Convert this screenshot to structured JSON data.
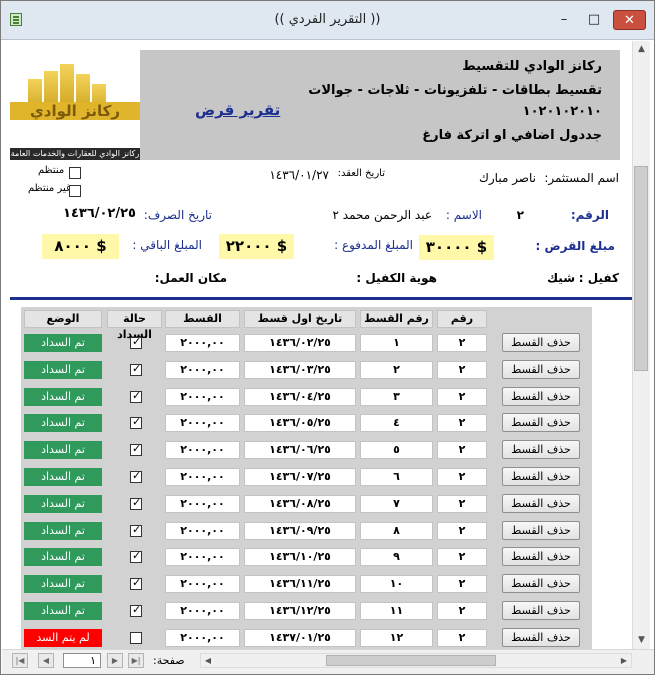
{
  "window": {
    "title": "(( التقرير الفردي ))",
    "controls": {
      "minimize": "–",
      "maximize": "□",
      "close": "✕"
    }
  },
  "logo": {
    "brand": "ركانز الوادي",
    "tagline": "ركانز الوادي للعقارات والخدمات العامة"
  },
  "header": {
    "report_title": "تقرير قرض",
    "company_name": "ركانز الوادي للتقسيط",
    "products": "تقسيط بطاقات - تلفزيونات - ثلاجات - جوالات",
    "phone": "١٠٢٠١٠٢٠١٠",
    "subtitle": "جددول اضافي او اتركة فارغ"
  },
  "info": {
    "investor_label": "اسم المستثمر:",
    "investor_value": "ناصر مبارك",
    "contract_date_label": "تاريخ العقد:",
    "contract_date_value": "١٤٣٦/٠١/٢٧",
    "regular_label": "منتظم",
    "irregular_label": "غير منتظم",
    "number_label": "الرقم:",
    "number_value": "٢",
    "name_label": "الاسم :",
    "name_value": "عبد الرحمن محمد ٢",
    "disbursement_label": "تاريخ الصرف:",
    "disbursement_value": "١٤٣٦/٠٢/٢٥",
    "loan_amount_label": "مبلغ القرض :",
    "loan_amount_value": "٣٠٠٠٠ $",
    "paid_amount_label": "المبلغ المدفوع :",
    "paid_amount_value": "٢٢٠٠٠ $",
    "remaining_label": "المبلغ الباقي :",
    "remaining_value": "٨٠٠٠ $",
    "guarantor_label": "كفيل :",
    "guarantor_value": "شيك",
    "guarantor_id_label": "هوية الكفيل :",
    "workplace_label": "مكان العمل:"
  },
  "table": {
    "headers": {
      "number": "رقم",
      "installment_number": "رقم القسط",
      "first_date": "تاريخ اول قسط",
      "installment": "القسط",
      "payment_status": "حالة السداد",
      "state": "الوضع"
    },
    "delete_label": "حذف القسط",
    "rows": [
      {
        "number": "٢",
        "installment_number": "١",
        "date": "١٤٣٦/٠٢/٢٥",
        "amount": "٢٠٠٠,٠٠",
        "paid": true,
        "status": "تم السداد"
      },
      {
        "number": "٢",
        "installment_number": "٢",
        "date": "١٤٣٦/٠٣/٢٥",
        "amount": "٢٠٠٠,٠٠",
        "paid": true,
        "status": "تم السداد"
      },
      {
        "number": "٢",
        "installment_number": "٣",
        "date": "١٤٣٦/٠٤/٢٥",
        "amount": "٢٠٠٠,٠٠",
        "paid": true,
        "status": "تم السداد"
      },
      {
        "number": "٢",
        "installment_number": "٤",
        "date": "١٤٣٦/٠٥/٢٥",
        "amount": "٢٠٠٠,٠٠",
        "paid": true,
        "status": "تم السداد"
      },
      {
        "number": "٢",
        "installment_number": "٥",
        "date": "١٤٣٦/٠٦/٢٥",
        "amount": "٢٠٠٠,٠٠",
        "paid": true,
        "status": "تم السداد"
      },
      {
        "number": "٢",
        "installment_number": "٦",
        "date": "١٤٣٦/٠٧/٢٥",
        "amount": "٢٠٠٠,٠٠",
        "paid": true,
        "status": "تم السداد"
      },
      {
        "number": "٢",
        "installment_number": "٧",
        "date": "١٤٣٦/٠٨/٢٥",
        "amount": "٢٠٠٠,٠٠",
        "paid": true,
        "status": "تم السداد"
      },
      {
        "number": "٢",
        "installment_number": "٨",
        "date": "١٤٣٦/٠٩/٢٥",
        "amount": "٢٠٠٠,٠٠",
        "paid": true,
        "status": "تم السداد"
      },
      {
        "number": "٢",
        "installment_number": "٩",
        "date": "١٤٣٦/١٠/٢٥",
        "amount": "٢٠٠٠,٠٠",
        "paid": true,
        "status": "تم السداد"
      },
      {
        "number": "٢",
        "installment_number": "١٠",
        "date": "١٤٣٦/١١/٢٥",
        "amount": "٢٠٠٠,٠٠",
        "paid": true,
        "status": "تم السداد"
      },
      {
        "number": "٢",
        "installment_number": "١١",
        "date": "١٤٣٦/١٢/٢٥",
        "amount": "٢٠٠٠,٠٠",
        "paid": true,
        "status": "تم السداد"
      },
      {
        "number": "٢",
        "installment_number": "١٢",
        "date": "١٤٣٧/٠١/٢٥",
        "amount": "٢٠٠٠,٠٠",
        "paid": false,
        "status": "لم يتم السد"
      }
    ]
  },
  "footer": {
    "page_label": "صفحة:",
    "page_value": "١"
  },
  "colors": {
    "accent": "#1d2f8f",
    "paid": "#2f9a5c",
    "unpaid": "#ff0000",
    "money_bg": "#fff8a8"
  }
}
